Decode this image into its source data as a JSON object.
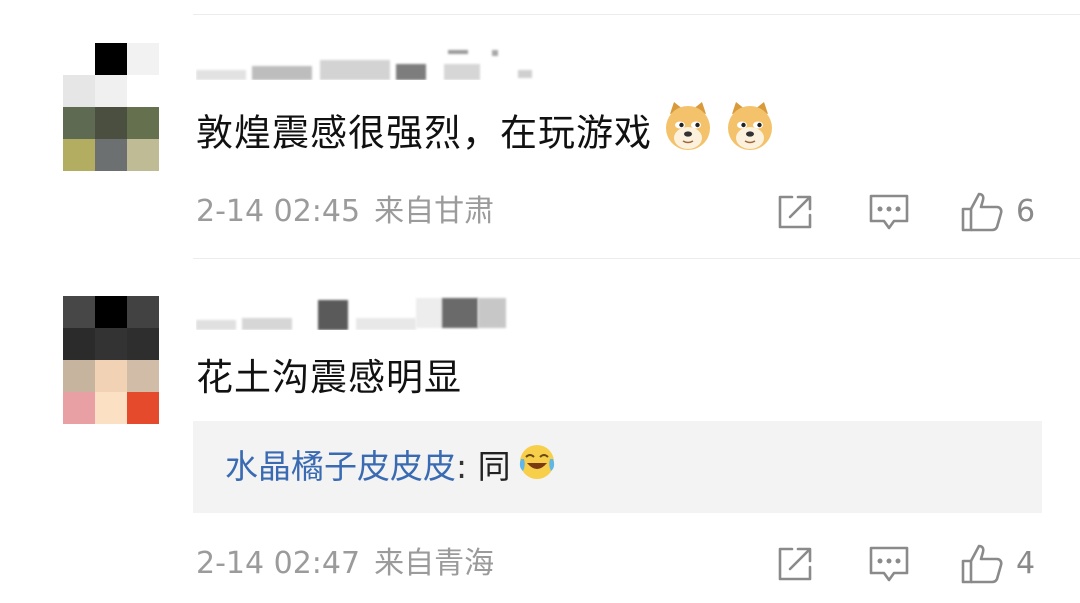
{
  "comments": [
    {
      "username": "",
      "text": "敦煌震感很强烈，在玩游戏",
      "emojis": [
        "doge-emoji",
        "doge-emoji"
      ],
      "time": "2-14 02:45",
      "location": "来自甘肃",
      "likes": "6"
    },
    {
      "username": "",
      "text": "花土沟震感明显",
      "time": "2-14 02:47",
      "location": "来自青海",
      "likes": "4",
      "reply": {
        "user": "水晶橘子皮皮皮",
        "separator": ":",
        "text": "同",
        "emoji": "laugh-cry-emoji"
      }
    }
  ],
  "colors": {
    "reply_user": "#3a6bb2",
    "meta_text": "#9b9b9b",
    "reply_background": "#f3f3f3"
  }
}
